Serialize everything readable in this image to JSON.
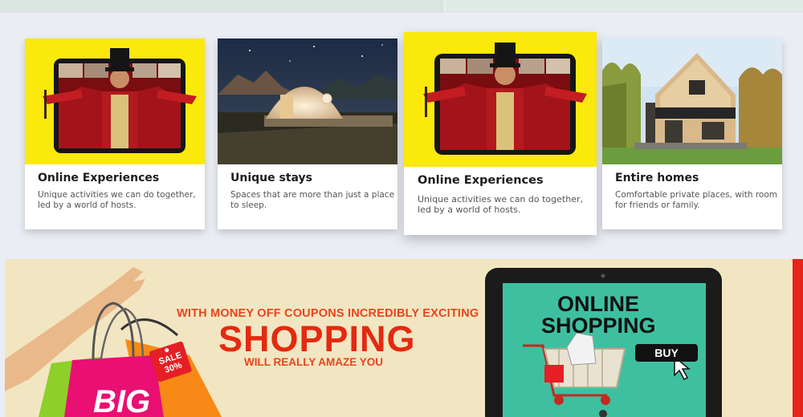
{
  "cards": [
    {
      "title": "Online Experiences",
      "desc_line1": "Unique activities we can do together,",
      "desc_line2": "led by a world of hosts.",
      "image": "performer-video-call-image"
    },
    {
      "title": "Unique stays",
      "desc_line1": "Spaces that are more than just a place",
      "desc_line2": "to sleep.",
      "image": "dome-tent-night-image"
    },
    {
      "title": "Online Experiences",
      "desc_line1": "Unique activities we can do together,",
      "desc_line2": "led by a world of hosts.",
      "image": "performer-video-call-image"
    },
    {
      "title": "Entire homes",
      "desc_line1": "Comfortable private places, with room",
      "desc_line2": "for friends or family.",
      "image": "modern-cabin-image"
    }
  ],
  "banner": {
    "line1": "WITH MONEY OFF COUPONS INCREDIBLY EXCITING",
    "line2": "SHOPPING",
    "line3": "WILL REALLY AMAZE YOU",
    "screen_line1": "ONLINE",
    "screen_line2": "SHOPPING",
    "buy_label": "BUY",
    "tag_line1": "SALE",
    "tag_line2": "30%",
    "bag_text": "BIG"
  },
  "colors": {
    "page_bg": "#ebedf5",
    "banner_bg": "#f2e6c2",
    "accent_red": "#e32a10",
    "card_yellow": "#fbe80c",
    "screen_green": "#3ec0a0"
  }
}
